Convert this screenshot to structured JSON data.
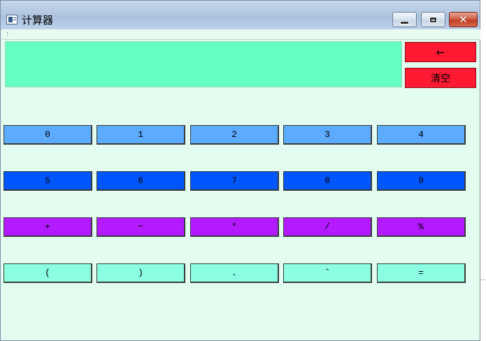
{
  "window": {
    "title": "计算器",
    "close_glyph": "✕"
  },
  "menu": {
    "grip": ":"
  },
  "display": {
    "value": ""
  },
  "controls": {
    "backspace_label": "←",
    "clear_label": "清空"
  },
  "keys": {
    "row1": [
      "0",
      "1",
      "2",
      "3",
      "4"
    ],
    "row2": [
      "5",
      "6",
      "7",
      "8",
      "9"
    ],
    "row3": [
      "+",
      "−",
      "*",
      "/",
      "%"
    ],
    "row4": [
      "(",
      ")",
      ".",
      "ˆ",
      "="
    ]
  },
  "colors": {
    "background": "#e2fdf0",
    "display": "#66ffc2",
    "control_buttons": "#ff1a33",
    "row1": "#5cabff",
    "row2": "#0057ff",
    "row3": "#b31aff",
    "row4": "#8cffe3"
  },
  "icons": {
    "app": "calculator-app-icon",
    "minimize": "minimize-icon",
    "maximize": "maximize-icon",
    "close": "close-icon"
  }
}
